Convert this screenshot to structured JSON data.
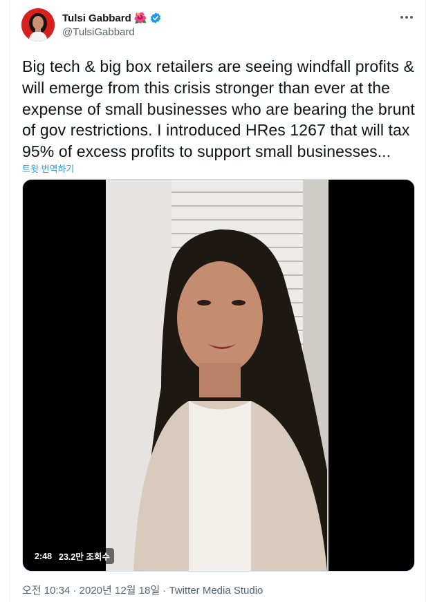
{
  "author": {
    "name": "Tulsi Gabbard",
    "handle": "@TulsiGabbard",
    "flower_emoji": "🌺"
  },
  "tweet": {
    "text": "Big tech & big box retailers are seeing windfall profits &\nwill emerge from this crisis stronger than ever at the\nexpense of small businesses who are bearing the brunt\nof gov restrictions. I introduced HRes 1267 that will tax\n95% of excess profits to support small businesses...",
    "translate_label": "트윗 번역하기"
  },
  "video": {
    "duration": "2:48",
    "views": "23.2만 조회수"
  },
  "footer": {
    "time": "오전 10:34",
    "date": "2020년 12월 18일",
    "source": "Twitter Media Studio",
    "separator": "·"
  },
  "colors": {
    "accent": "#1d9bf0",
    "secondary_text": "#536471",
    "avatar_bg": "#d8201f"
  }
}
